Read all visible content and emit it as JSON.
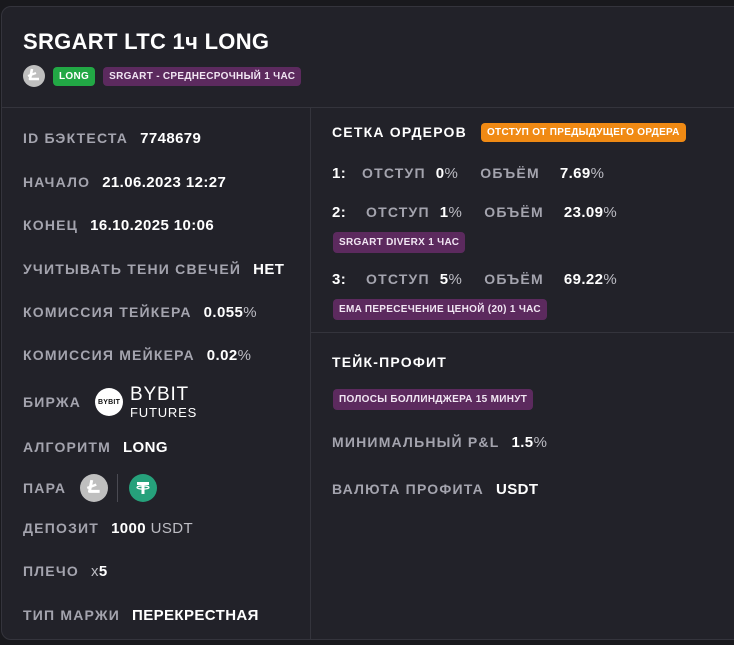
{
  "header": {
    "title": "SRGART LTC 1ч LONG",
    "coin_icon": "litecoin-icon",
    "badge_long": "LONG",
    "badge_strategy": "SRGART - СРЕДНЕСРОЧНЫЙ 1 ЧАС"
  },
  "details": {
    "backtest_id_label": "ID БЭКТЕСТА",
    "backtest_id_value": "7748679",
    "start_label": "НАЧАЛО",
    "start_value": "21.06.2023 12:27",
    "end_label": "КОНЕЦ",
    "end_value": "16.10.2025 10:06",
    "shadows_label": "УЧИТЫВАТЬ ТЕНИ СВЕЧЕЙ",
    "shadows_value": "НЕТ",
    "taker_fee_label": "КОМИССИЯ ТЕЙКЕРА",
    "taker_fee_value": "0.055",
    "taker_fee_unit": "%",
    "maker_fee_label": "КОМИССИЯ МЕЙКЕРА",
    "maker_fee_value": "0.02",
    "maker_fee_unit": "%",
    "exchange_label": "БИРЖА",
    "exchange_logo_text": "BYBIT",
    "exchange_name": "BYBIT",
    "exchange_sub": "FUTURES",
    "algorithm_label": "АЛГОРИТМ",
    "algorithm_value": "LONG",
    "pair_label": "ПАРА",
    "pair_base_icon": "litecoin-icon",
    "pair_quote_icon": "tether-icon",
    "deposit_label": "ДЕПОЗИТ",
    "deposit_value": "1000",
    "deposit_unit": "USDT",
    "leverage_label": "ПЛЕЧО",
    "leverage_prefix": "x",
    "leverage_value": "5",
    "margin_label": "ТИП МАРЖИ",
    "margin_value": "ПЕРЕКРЕСТНАЯ"
  },
  "orders": {
    "title": "СЕТКА ОРДЕРОВ",
    "mode_badge": "ОТСТУП ОТ ПРЕДЫДУЩЕГО ОРДЕРА",
    "offset_label": "ОТСТУП",
    "volume_label": "ОБЪЁМ",
    "percent_unit": "%",
    "items": [
      {
        "num": "1:",
        "offset": "0",
        "volume": "7.69",
        "indicator": ""
      },
      {
        "num": "2:",
        "offset": "1",
        "volume": "23.09",
        "indicator": "SRGART DIVERX 1 ЧАС"
      },
      {
        "num": "3:",
        "offset": "5",
        "volume": "69.22",
        "indicator": "EMA ПЕРЕСЕЧЕНИЕ ЦЕНОЙ (20) 1 ЧАС"
      }
    ]
  },
  "take_profit": {
    "title": "ТЕЙК-ПРОФИТ",
    "indicator": "ПОЛОСЫ БОЛЛИНДЖЕРА 15 МИНУТ",
    "min_pnl_label": "МИНИМАЛЬНЫЙ P&L",
    "min_pnl_value": "1.5",
    "min_pnl_unit": "%",
    "currency_label": "ВАЛЮТА ПРОФИТА",
    "currency_value": "USDT"
  },
  "colors": {
    "background": "#19191d",
    "card": "#222229",
    "label": "#a4a4ae",
    "badge_green": "#22a845",
    "badge_purple": "#5c2a5e",
    "badge_orange": "#f08a14",
    "tether": "#26a17b"
  }
}
